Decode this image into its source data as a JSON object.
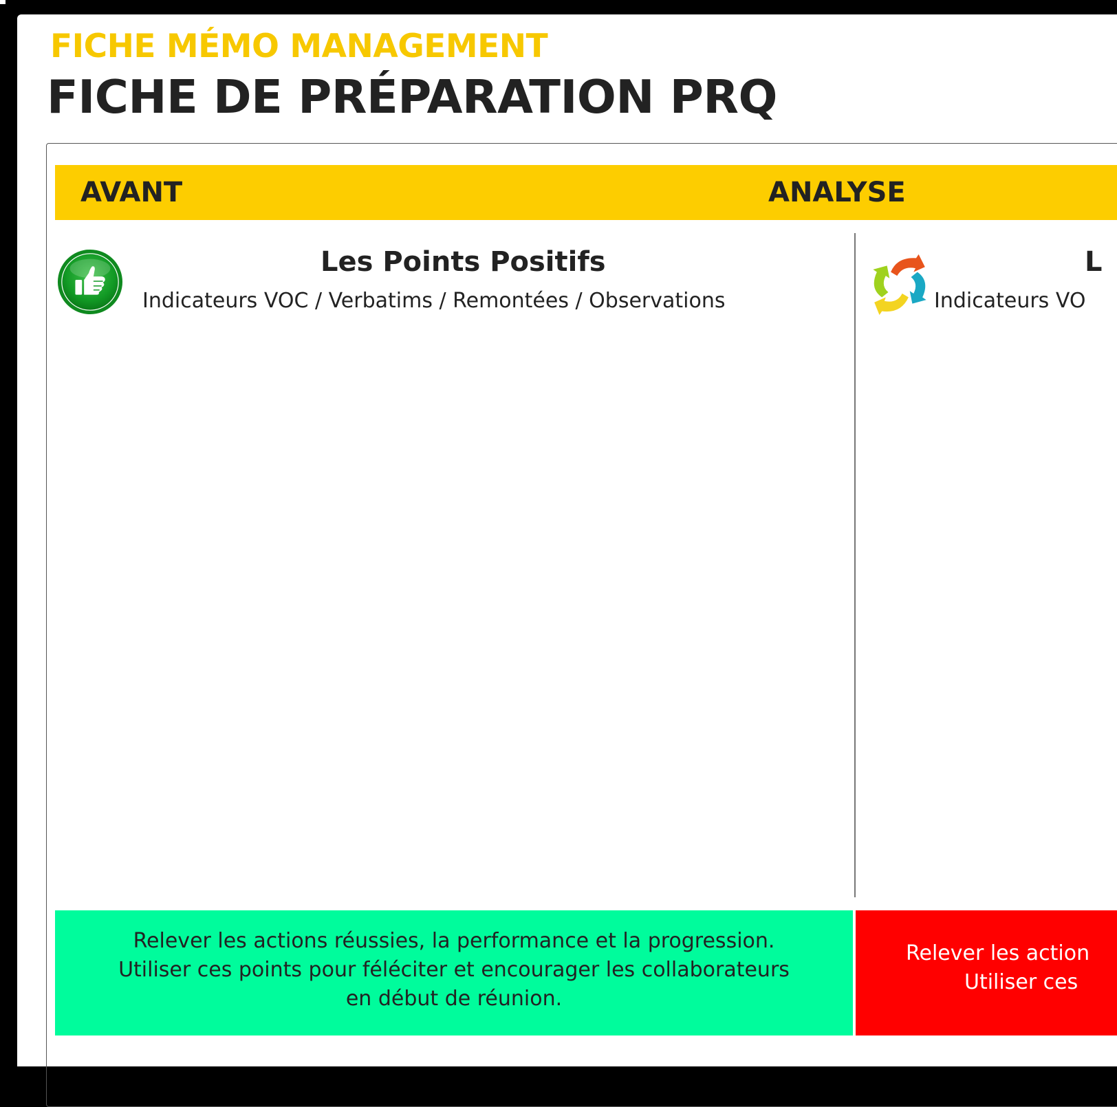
{
  "header": {
    "kicker": "FICHE MÉMO MANAGEMENT",
    "title": "FICHE DE PRÉPARATION PRQ"
  },
  "band": {
    "left_label": "AVANT",
    "right_label": "ANALYSE"
  },
  "sections": {
    "positive": {
      "title": "Les Points Positifs",
      "subtitle": "Indicateurs VOC / Verbatims / Remontées / Observations",
      "icon": "thumbs-up-icon",
      "note_lines": [
        "Relever les actions réussies, la performance et la progression.",
        "Utiliser ces points pour féléciter et encourager les collaborateurs",
        "en début de réunion."
      ]
    },
    "analysis": {
      "title_visible": "L",
      "subtitle_visible": "Indicateurs VO",
      "icon": "cycle-arrows-icon",
      "note_lines_visible": [
        "Relever les action",
        "Utiliser ces"
      ]
    }
  },
  "colors": {
    "page_background": "#000000",
    "sheet": "#ffffff",
    "kicker": "#f7c800",
    "band": "#fdcd00",
    "text": "#222222",
    "note_green": "#00fc9c",
    "note_red": "#ff0000"
  }
}
